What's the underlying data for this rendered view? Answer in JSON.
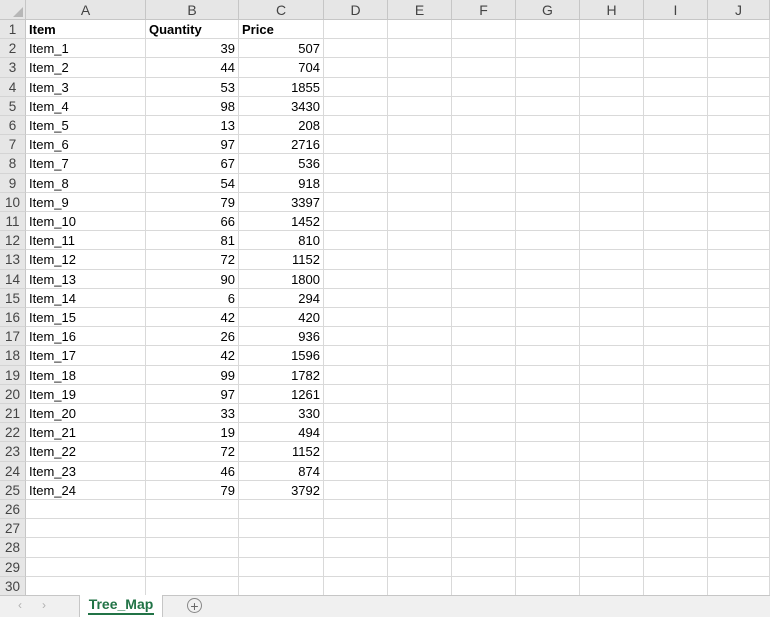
{
  "columns": [
    "A",
    "B",
    "C",
    "D",
    "E",
    "F",
    "G",
    "H",
    "I",
    "J"
  ],
  "rows": [
    "1",
    "2",
    "3",
    "4",
    "5",
    "6",
    "7",
    "8",
    "9",
    "10",
    "11",
    "12",
    "13",
    "14",
    "15",
    "16",
    "17",
    "18",
    "19",
    "20",
    "21",
    "22",
    "23",
    "24",
    "25",
    "26",
    "27",
    "28",
    "29",
    "30"
  ],
  "headers": [
    "Item",
    "Quantity",
    "Price"
  ],
  "data": [
    [
      "Item_1",
      "39",
      "507"
    ],
    [
      "Item_2",
      "44",
      "704"
    ],
    [
      "Item_3",
      "53",
      "1855"
    ],
    [
      "Item_4",
      "98",
      "3430"
    ],
    [
      "Item_5",
      "13",
      "208"
    ],
    [
      "Item_6",
      "97",
      "2716"
    ],
    [
      "Item_7",
      "67",
      "536"
    ],
    [
      "Item_8",
      "54",
      "918"
    ],
    [
      "Item_9",
      "79",
      "3397"
    ],
    [
      "Item_10",
      "66",
      "1452"
    ],
    [
      "Item_11",
      "81",
      "810"
    ],
    [
      "Item_12",
      "72",
      "1152"
    ],
    [
      "Item_13",
      "90",
      "1800"
    ],
    [
      "Item_14",
      "6",
      "294"
    ],
    [
      "Item_15",
      "42",
      "420"
    ],
    [
      "Item_16",
      "26",
      "936"
    ],
    [
      "Item_17",
      "42",
      "1596"
    ],
    [
      "Item_18",
      "99",
      "1782"
    ],
    [
      "Item_19",
      "97",
      "1261"
    ],
    [
      "Item_20",
      "33",
      "330"
    ],
    [
      "Item_21",
      "19",
      "494"
    ],
    [
      "Item_22",
      "72",
      "1152"
    ],
    [
      "Item_23",
      "46",
      "874"
    ],
    [
      "Item_24",
      "79",
      "3792"
    ]
  ],
  "tabs": [
    {
      "label": "Tree_Map",
      "active": true
    }
  ],
  "nav": {
    "prev": "‹",
    "next": "›"
  },
  "add_sheet_symbol": "+",
  "accent_color": "#217346"
}
